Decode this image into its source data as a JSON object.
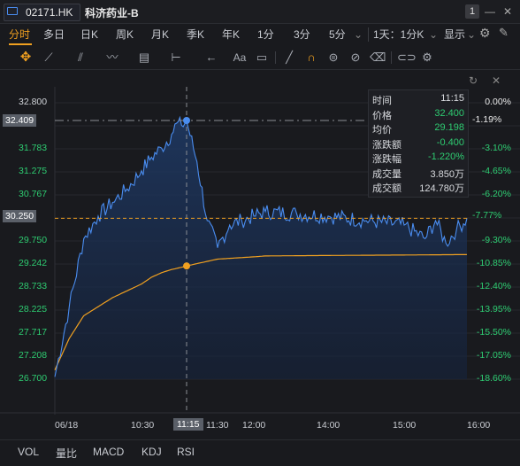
{
  "header": {
    "code": "02171.HK",
    "name": "科济药业-B",
    "window_num": "1"
  },
  "tabs": [
    "分时",
    "多日",
    "日K",
    "周K",
    "月K",
    "季K",
    "年K",
    "1分",
    "3分",
    "5分"
  ],
  "active_tab": "分时",
  "right_controls": {
    "interval": "1天：1分K",
    "display": "显示"
  },
  "icons": {
    "toolbar": [
      "crosshair-icon",
      "line-draw-icon",
      "channel-draw-icon",
      "wave-icon",
      "grid-icon",
      "range-icon",
      "arrow-icon",
      "text-icon",
      "note-icon",
      "pencil-icon",
      "magnet-icon",
      "lock-icon",
      "hide-icon",
      "trash-icon",
      "link-icon",
      "settings-icon"
    ]
  },
  "info_panel": [
    {
      "k": "时间",
      "v": "11:15",
      "color": "white"
    },
    {
      "k": "价格",
      "v": "32.400",
      "color": "green"
    },
    {
      "k": "均价",
      "v": "29.198",
      "color": "green"
    },
    {
      "k": "涨跌额",
      "v": "-0.400",
      "color": "green"
    },
    {
      "k": "涨跌幅",
      "v": "-1.220%",
      "color": "green"
    },
    {
      "k": "成交量",
      "v": "3.850万",
      "color": "white"
    },
    {
      "k": "成交额",
      "v": "124.780万",
      "color": "white"
    }
  ],
  "cursor": {
    "price": "32.409",
    "pct": "-1.19%",
    "time": "11:15"
  },
  "current": {
    "price": "30.250",
    "pct": "-7.77%"
  },
  "bottom_indicators": [
    "VOL",
    "量比",
    "MACD",
    "KDJ",
    "RSI"
  ],
  "colors": {
    "price_line": "#4a8df0",
    "avg_line": "#f0a020",
    "down": "#2ecc71",
    "accent": "#f0a020"
  },
  "chart_data": {
    "type": "line",
    "y_ticks": [
      "32.800",
      "32.409",
      "31.783",
      "31.275",
      "30.767",
      "30.250",
      "29.750",
      "29.242",
      "28.733",
      "28.225",
      "27.717",
      "27.208",
      "26.700"
    ],
    "pct_ticks": [
      "0.00%",
      "-1.19%",
      "-3.10%",
      "-4.65%",
      "-6.20%",
      "-7.77%",
      "-9.30%",
      "-10.85%",
      "-12.40%",
      "-13.95%",
      "-15.50%",
      "-17.05%",
      "-18.60%"
    ],
    "x_ticks": [
      "06/18",
      "10:30",
      "11:15",
      "11:30",
      "12:00",
      "14:00",
      "15:00",
      "16:00"
    ],
    "ylim": [
      26.7,
      32.8
    ],
    "series": [
      {
        "x": [
          "09:30",
          "09:40",
          "09:50",
          "10:00",
          "10:10",
          "10:20",
          "10:30",
          "10:40",
          "10:50",
          "11:00",
          "11:05",
          "11:10",
          "11:15",
          "11:20",
          "11:25",
          "11:30",
          "11:40",
          "11:50",
          "12:00",
          "13:00",
          "13:30",
          "14:00",
          "14:30",
          "15:00",
          "15:20",
          "15:30",
          "15:40",
          "15:50",
          "16:00"
        ],
        "values": [
          26.75,
          28.3,
          29.8,
          30.3,
          30.6,
          30.9,
          31.3,
          31.6,
          31.8,
          32.1,
          32.35,
          32.3,
          32.4,
          31.5,
          30.2,
          29.6,
          30.1,
          30.2,
          30.3,
          30.4,
          30.35,
          30.3,
          30.2,
          30.1,
          29.8,
          30.2,
          29.7,
          30.0,
          30.25
        ]
      },
      {
        "x": [
          "09:30",
          "09:40",
          "09:50",
          "10:00",
          "10:10",
          "10:20",
          "10:30",
          "10:40",
          "10:50",
          "11:00",
          "11:10",
          "11:15",
          "11:30",
          "12:00",
          "13:00",
          "14:00",
          "15:00",
          "16:00"
        ],
        "values": [
          26.9,
          27.6,
          28.1,
          28.3,
          28.5,
          28.65,
          28.8,
          28.95,
          29.05,
          29.12,
          29.17,
          29.2,
          29.35,
          29.4,
          29.42,
          29.43,
          29.44,
          29.45
        ]
      }
    ]
  }
}
